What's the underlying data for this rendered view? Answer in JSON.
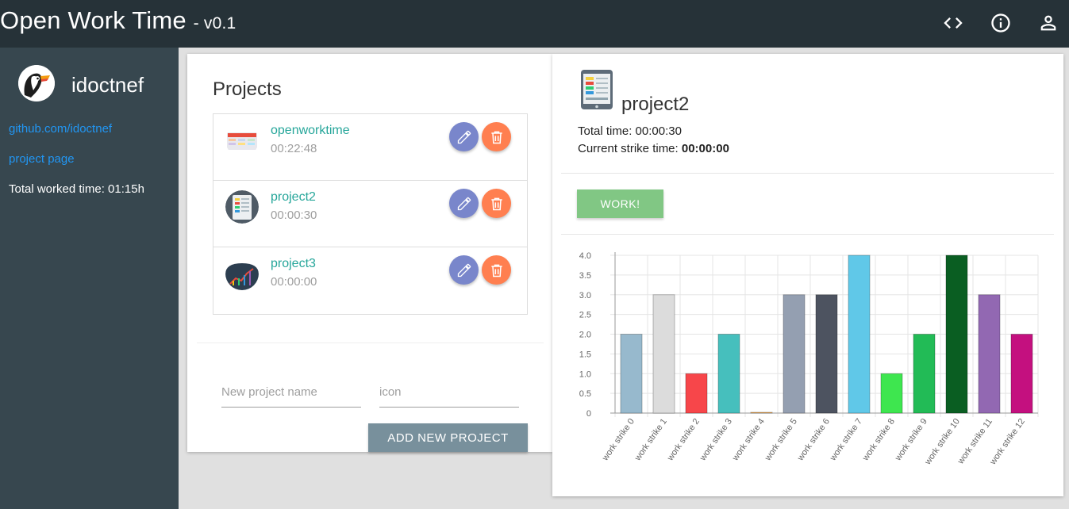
{
  "header": {
    "title": "Open Work Time",
    "version": "- v0.1",
    "icons": [
      "code-icon",
      "info-icon",
      "account-icon"
    ]
  },
  "sidebar": {
    "username": "idoctnef",
    "github_link": "github.com/idoctnef",
    "project_page_link": "project page",
    "total_worked": "Total worked time: 01:15h"
  },
  "projects": {
    "title": "Projects",
    "items": [
      {
        "name": "openworktime",
        "time": "00:22:48",
        "icon": "kanban-board-icon"
      },
      {
        "name": "project2",
        "time": "00:00:30",
        "icon": "tablet-list-icon"
      },
      {
        "name": "project3",
        "time": "00:00:00",
        "icon": "line-chart-icon"
      }
    ],
    "new_name_placeholder": "New project name",
    "icon_placeholder": "icon",
    "add_button": "ADD NEW PROJECT"
  },
  "detail": {
    "name": "project2",
    "total_time_label": "Total time: ",
    "total_time": "00:00:30",
    "current_strike_label": "Current strike time: ",
    "current_strike": "00:00:00",
    "work_button": "WORK!"
  },
  "chart_data": {
    "type": "bar",
    "categories": [
      "work strike 0",
      "work strike 1",
      "work strike 2",
      "work strike 3",
      "work strike 4",
      "work strike 5",
      "work strike 6",
      "work strike 7",
      "work strike 8",
      "work strike 9",
      "work strike 10",
      "work strike 11",
      "work strike 12"
    ],
    "values": [
      2,
      3,
      1,
      2,
      0,
      3,
      3,
      4,
      1,
      2,
      4,
      3,
      2
    ],
    "colors": [
      "#97b9cd",
      "#dcdcdc",
      "#f7464a",
      "#46bfbd",
      "#fdb45c",
      "#949fb1",
      "#4d5360",
      "#60c8e8",
      "#3ee64f",
      "#22bb56",
      "#0a5e22",
      "#9268b2",
      "#c4107f"
    ],
    "ylim": [
      0,
      4
    ],
    "yticks": [
      "0",
      "0.5",
      "1.0",
      "1.5",
      "2.0",
      "2.5",
      "3.0",
      "3.5",
      "4.0"
    ],
    "grid": true,
    "title": "",
    "xlabel": "",
    "ylabel": ""
  }
}
